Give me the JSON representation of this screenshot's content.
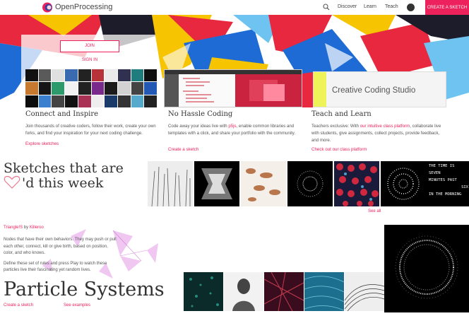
{
  "nav": {
    "brand": "OpenProcessing",
    "links": [
      "Discover",
      "Learn",
      "Teach"
    ],
    "cta": "CREATE A SKETCH"
  },
  "hero": {
    "join_label": "JOIN",
    "signin_label": "SIGN IN",
    "studio_title": "Creative Coding Studio"
  },
  "features": [
    {
      "title": "Connect and Inspire",
      "text": "Join thousands of creative coders, follow their work, create your own forks, and find your inspiration for your next coding challenge.",
      "link": "Explore sketches"
    },
    {
      "title": "No Hassle Coding",
      "text_before": "Code away your ideas live with ",
      "text_highlight": "p5js",
      "text_after": ", enable common libraries and templates with a click, and share your portfolio with the community.",
      "link": "Create a sketch"
    },
    {
      "title": "Teach and Learn",
      "text_before": "Teachers exclusive: With ",
      "text_highlight": "our intuitive class platform",
      "text_after": ", collaborate live with students, give assignments, collect projects, provide feedback, and more.",
      "link": "Check out our class platform"
    }
  ],
  "liked": {
    "title_line1": "Sketches that are",
    "title_line2": "'d this week",
    "see_all": "See all",
    "clock_text": [
      "THE TIME IS",
      "SEVEN",
      "MINUTES PAST",
      "SIX",
      "IN THE MORNING"
    ]
  },
  "particles": {
    "sketch_name": "Triangle!S",
    "by": "by",
    "author": "Killeroo",
    "desc1": "Nodes that have their own behaviors. They may push or pull each other, connect, kill or give birth, based on position, color, and who knows.",
    "desc2": "Define these set of rules and press Play to watch these particles live their fascinating yet random lives.",
    "title": "Particle Systems",
    "create_link": "Create a sketch",
    "examples_link": "See examples"
  },
  "colors": {
    "accent": "#ed225d"
  }
}
